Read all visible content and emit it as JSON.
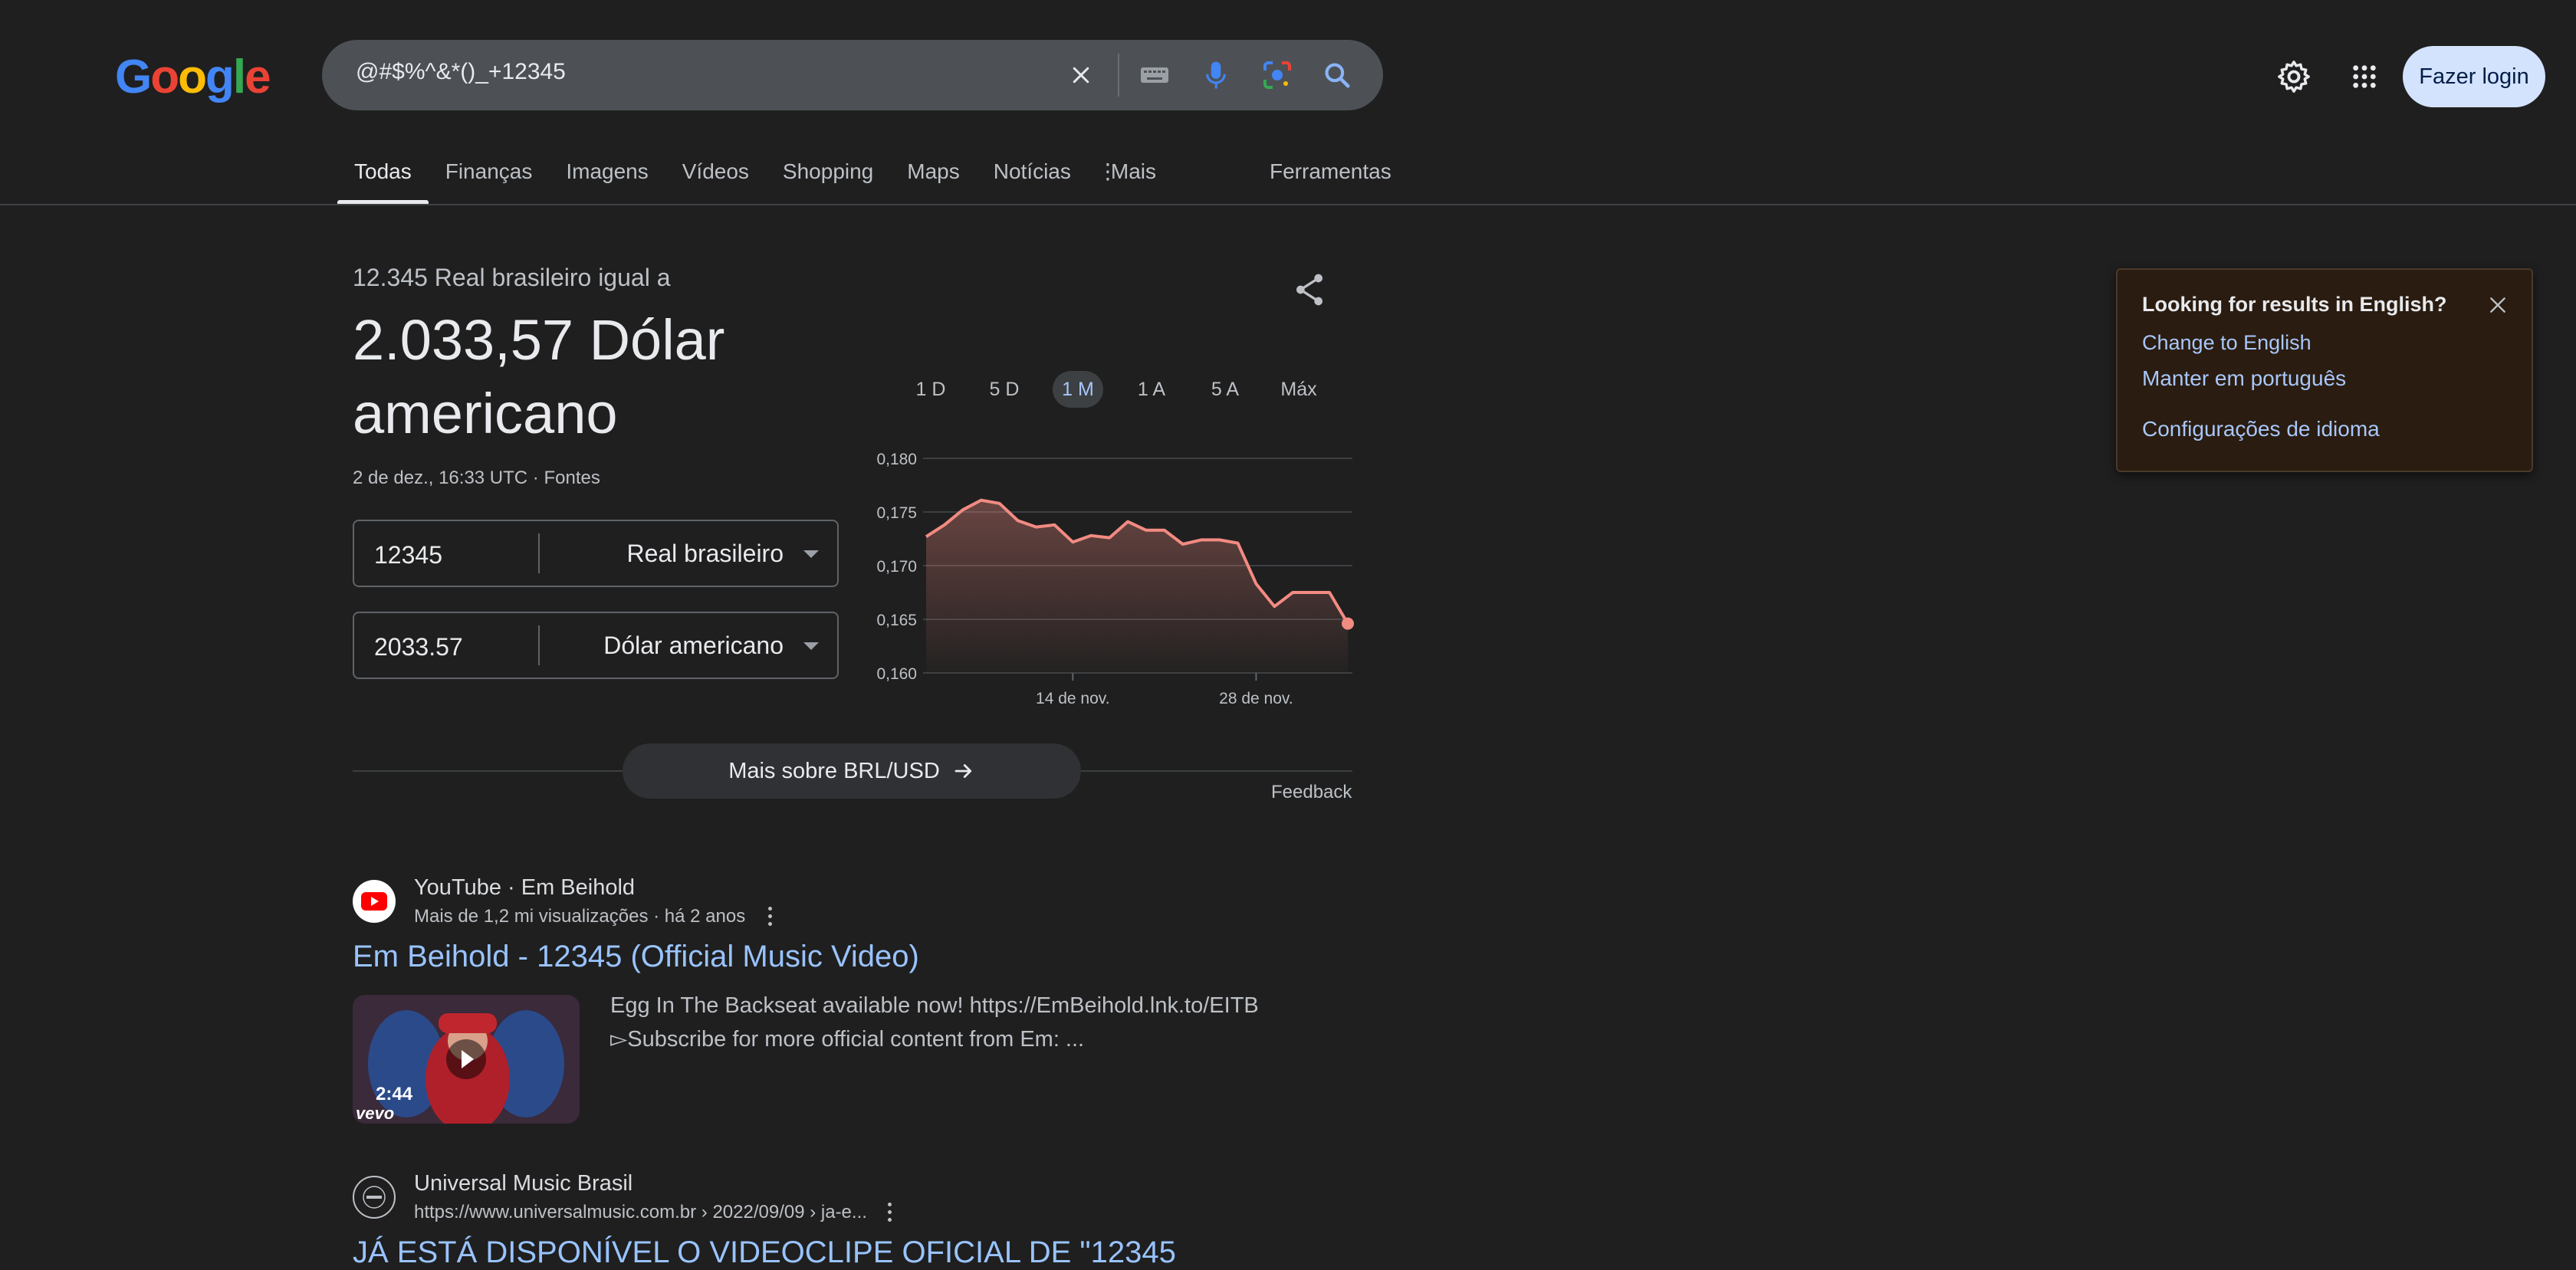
{
  "logo": {
    "letters": [
      "G",
      "o",
      "o",
      "g",
      "l",
      "e"
    ]
  },
  "search": {
    "query": "@#$%^&*()_+12345"
  },
  "header": {
    "login_label": "Fazer login"
  },
  "tabs": [
    {
      "label": "Todas"
    },
    {
      "label": "Finanças"
    },
    {
      "label": "Imagens"
    },
    {
      "label": "Vídeos"
    },
    {
      "label": "Shopping"
    },
    {
      "label": "Maps"
    },
    {
      "label": "Notícias"
    },
    {
      "label": "Mais"
    }
  ],
  "tools_label": "Ferramentas",
  "converter": {
    "subtitle": "12.345 Real brasileiro igual a",
    "result": "2.033,57 Dólar americano",
    "timestamp": "2 de dez., 16:33 UTC · Fontes",
    "from_value": "12345",
    "from_currency": "Real brasileiro",
    "to_value": "2033.57",
    "to_currency": "Dólar americano",
    "ranges": [
      "1 D",
      "5 D",
      "1 M",
      "1 A",
      "5 A",
      "Máx"
    ],
    "active_range": "1 M",
    "more_label": "Mais sobre BRL/USD",
    "feedback": "Feedback"
  },
  "chart_data": {
    "type": "area",
    "title": "",
    "xlabel": "",
    "ylabel": "",
    "ylim": [
      0.16,
      0.18
    ],
    "y_ticks": [
      "0,180",
      "0,175",
      "0,170",
      "0,165",
      "0,160"
    ],
    "x_ticks": [
      "14 de nov.",
      "28 de nov."
    ],
    "line_color": "#f28b82",
    "values": [
      0.1727,
      0.1738,
      0.1752,
      0.1761,
      0.1758,
      0.1742,
      0.1736,
      0.1738,
      0.1722,
      0.1728,
      0.1726,
      0.1741,
      0.1733,
      0.1733,
      0.172,
      0.1724,
      0.1724,
      0.1721,
      0.1683,
      0.1662,
      0.1675,
      0.1675,
      0.1675,
      0.1646
    ]
  },
  "results": [
    {
      "source": "YouTube · Em Beihold",
      "meta": "Mais de 1,2 mi visualizações · há 2 anos",
      "title": "Em Beihold - 12345 (Official Music Video)",
      "duration": "2:44",
      "watermark": "vevo",
      "snippet": "Egg In The Backseat available now! https://EmBeihold.lnk.to/EITB ▻Subscribe for more official content from Em: ..."
    },
    {
      "source": "Universal Music Brasil",
      "meta": "https://www.universalmusic.com.br › 2022/09/09 › ja-e...",
      "title": "JÁ ESTÁ DISPONÍVEL O VIDEOCLIPE OFICIAL DE \"12345"
    }
  ],
  "lang_popup": {
    "question": "Looking for results in English?",
    "change": "Change to English",
    "keep": "Manter em português",
    "settings": "Configurações de idioma"
  },
  "colors": {
    "background": "#1f1f1f",
    "link": "#99c3ff",
    "accent": "#a8c7fa",
    "chart_line": "#f28b82"
  }
}
